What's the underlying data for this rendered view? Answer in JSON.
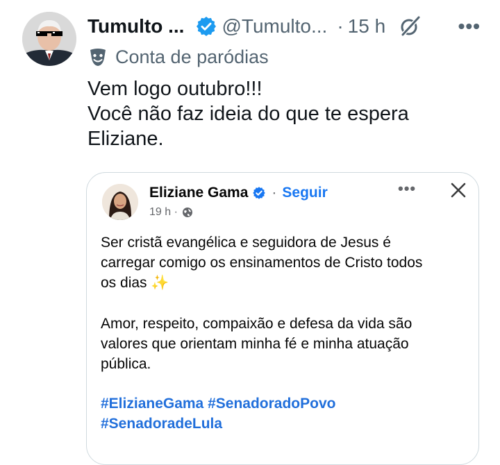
{
  "tweet": {
    "author_name": "Tumulto ...",
    "handle": "@Tumulto...",
    "separator": "·",
    "time": "15 h",
    "more_label": "•••",
    "parody_label": "Conta de paródias",
    "text_lines": [
      "Vem logo outubro!!!",
      "Você não faz ideia do que te espera",
      "Eliziane."
    ]
  },
  "quoted_post": {
    "author_name": "Eliziane Gama",
    "separator": "·",
    "follow_label": "Seguir",
    "time": "19 h ·",
    "more_label": "•••",
    "paragraph1_lines": [
      "Ser cristã evangélica e seguidora de Jesus é",
      "carregar comigo os ensinamentos de Cristo todos",
      "os dias"
    ],
    "sparkles_emoji": "✨",
    "paragraph2_lines": [
      "Amor, respeito, compaixão e defesa da vida são",
      "valores que orientam minha fé e minha atuação",
      "pública."
    ],
    "hashtag_lines": [
      "#ElizianeGama #SenadoradoPovo",
      "#SenadoradeLula"
    ]
  },
  "colors": {
    "text_primary": "#0f1419",
    "text_secondary": "#536471",
    "x_verified_blue": "#1d9bf0",
    "facebook_blue": "#1877f2",
    "hashtag_blue": "#216fdb",
    "card_border": "#cfd9de"
  },
  "icons": [
    "verified-badge-icon",
    "grok-icon",
    "more-icon",
    "parody-mask-icon",
    "fb-verified-badge-icon",
    "globe-icon",
    "close-icon",
    "sparkles-emoji"
  ]
}
